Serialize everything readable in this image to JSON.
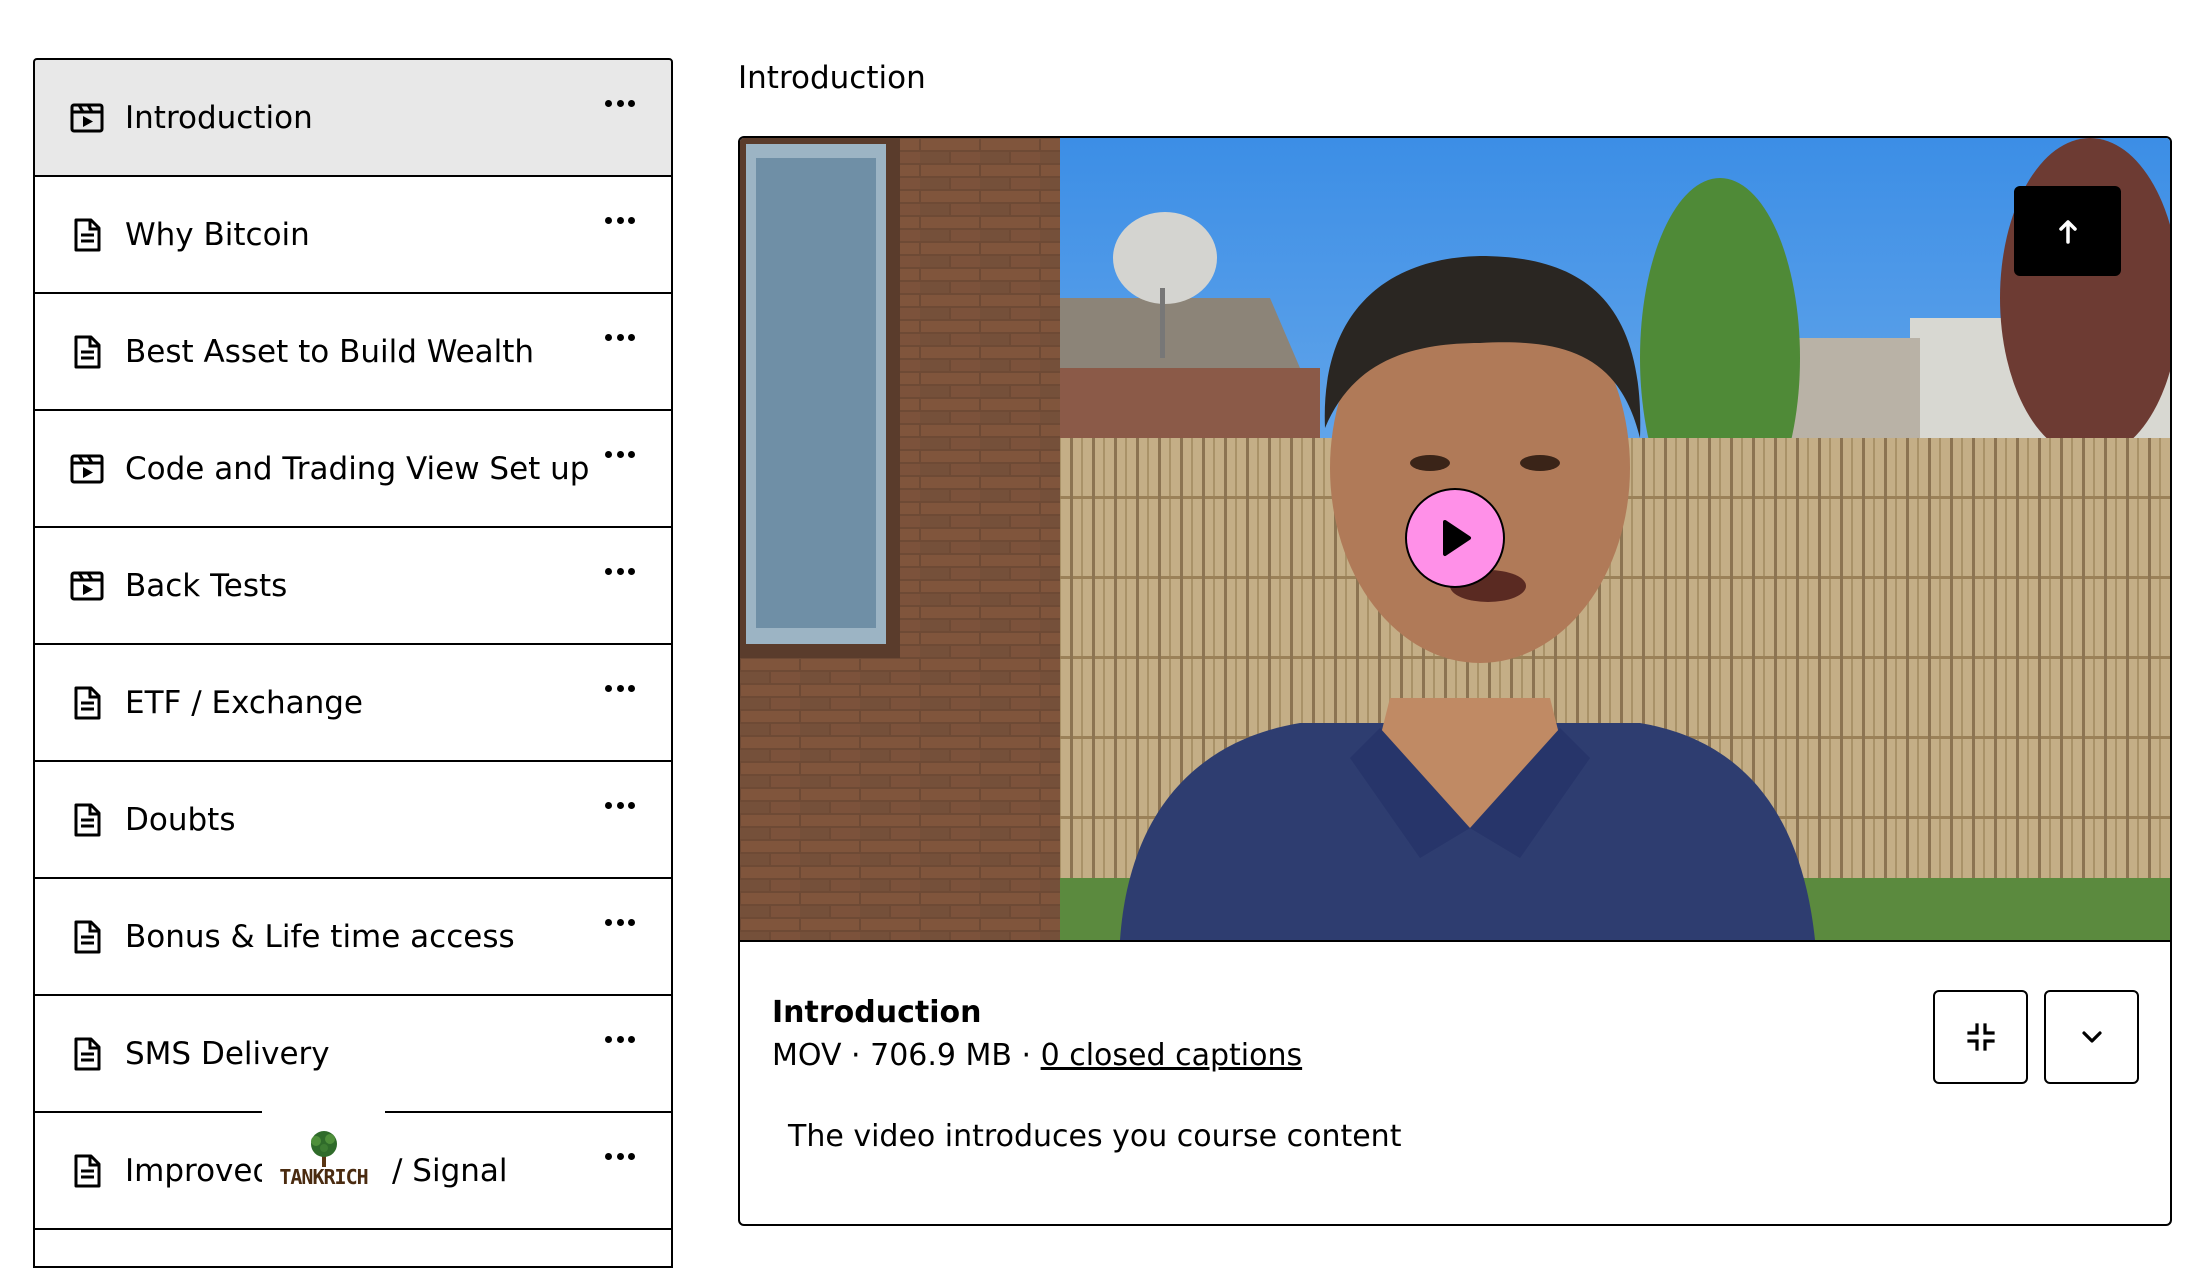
{
  "sidebar": {
    "items": [
      {
        "label": "Introduction",
        "icon": "video-file-icon",
        "active": true
      },
      {
        "label": "Why Bitcoin",
        "icon": "document-icon"
      },
      {
        "label": "Best Asset to Build Wealth",
        "icon": "document-icon"
      },
      {
        "label": "Code and Trading View Set up",
        "icon": "video-file-icon"
      },
      {
        "label": "Back Tests",
        "icon": "video-file-icon"
      },
      {
        "label": "ETF / Exchange",
        "icon": "document-icon"
      },
      {
        "label": "Doubts",
        "icon": "document-icon"
      },
      {
        "label": "Bonus & Life time access",
        "icon": "document-icon"
      },
      {
        "label": "SMS Delivery",
        "icon": "document-icon"
      },
      {
        "label": "Improved",
        "label_tail": "/ Signal",
        "icon": "document-icon"
      }
    ],
    "more_icon": "more-horizontal-icon"
  },
  "logo": {
    "text": "TANKRICH",
    "icon": "tree-icon"
  },
  "main": {
    "title": "Introduction",
    "media": {
      "file_name": "Introduction",
      "format": "MOV",
      "size": "706.9 MB",
      "separator": " · ",
      "captions_link": "0 closed captions",
      "description": "The video introduces you course content",
      "upload_icon": "arrow-up-icon",
      "play_icon": "play-icon",
      "collapse_icon": "collapse-icon",
      "expand_icon": "chevron-down-icon"
    }
  },
  "colors": {
    "active_item_bg": "#e8e8e8",
    "play_button": "#ff90e8",
    "border": "#000000"
  }
}
